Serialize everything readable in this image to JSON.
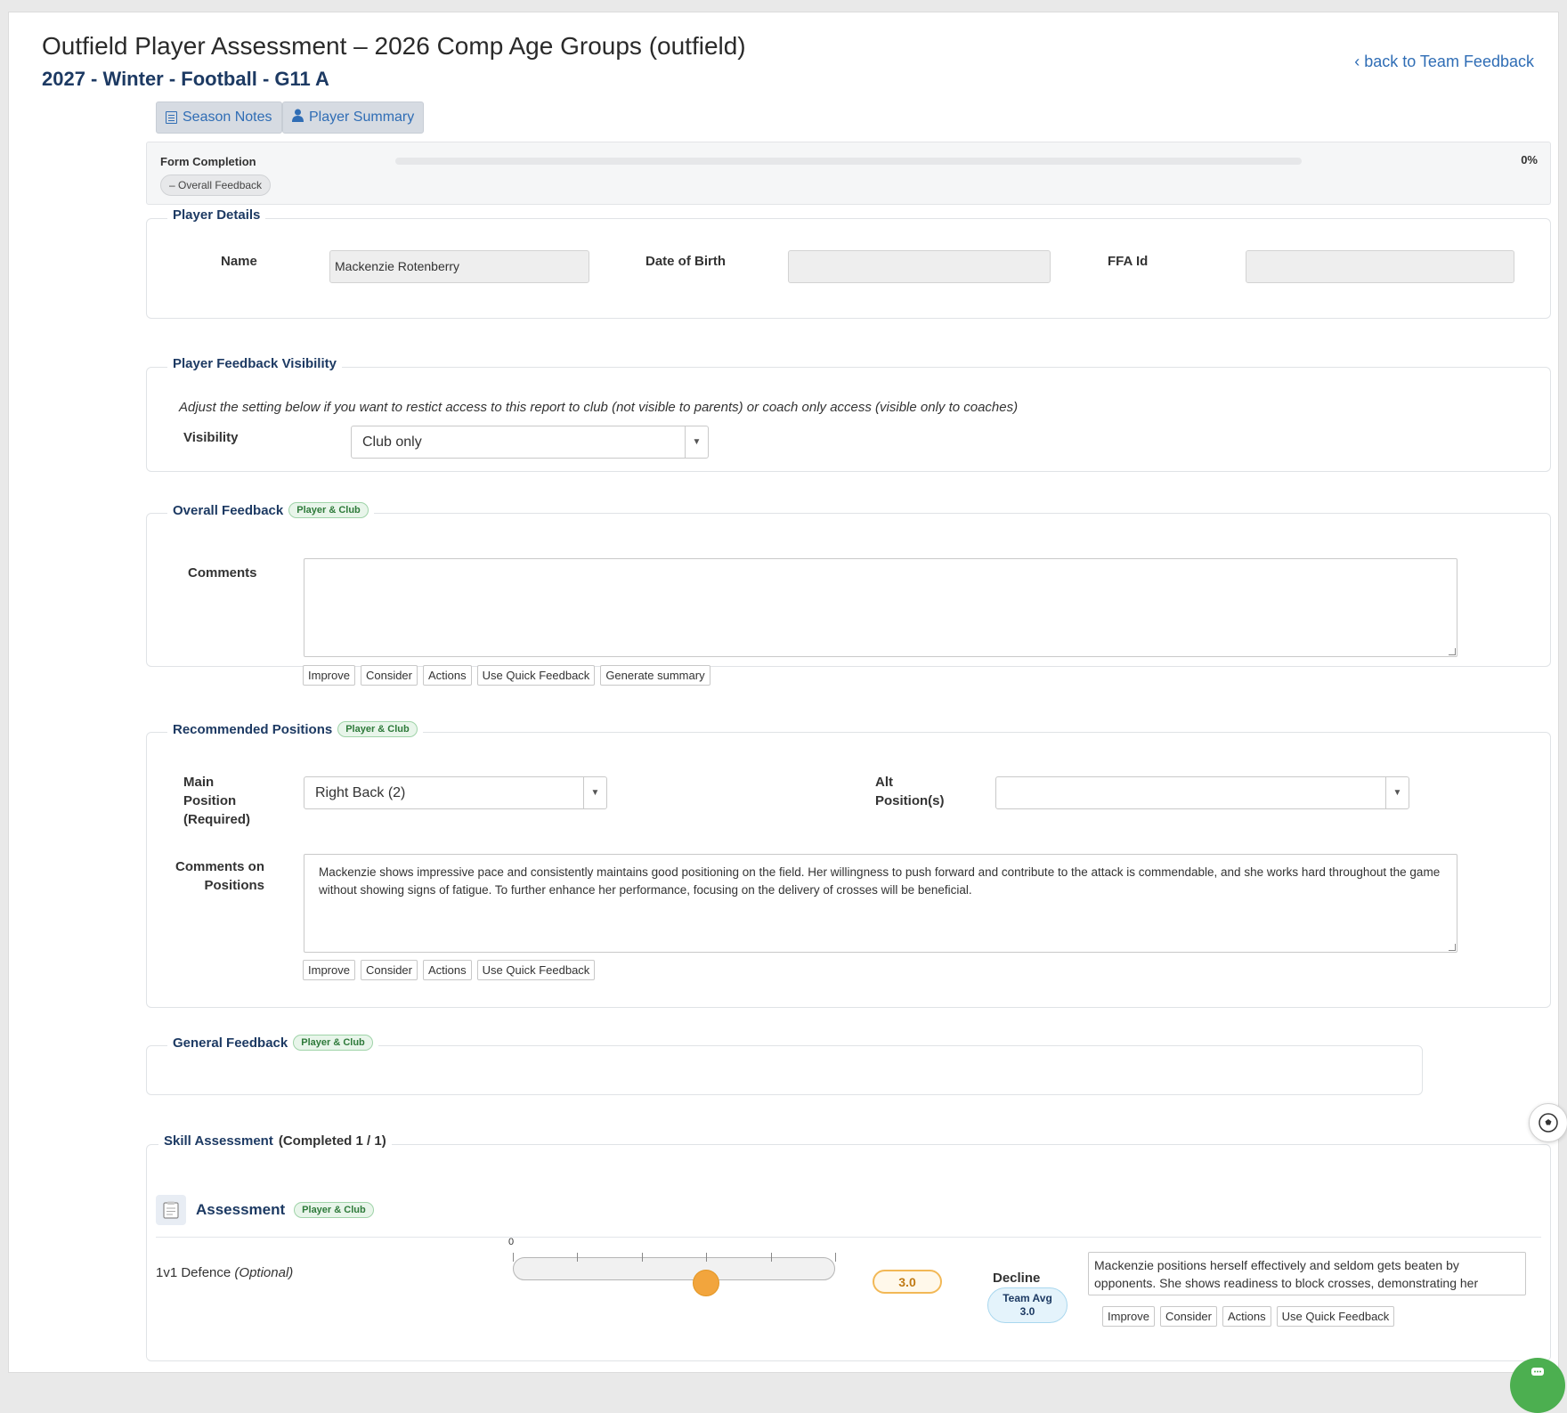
{
  "header": {
    "title": "Outfield Player Assessment – 2026 Comp Age Groups (outfield)",
    "subtitle": "2027 - Winter - Football - G11 A",
    "back_link": "‹ back to Team Feedback"
  },
  "toolbar": {
    "season_notes": "Season Notes",
    "player_summary": "Player Summary"
  },
  "completion": {
    "label": "Form Completion",
    "percent_text": "0%",
    "progress": 0,
    "toggle": "– Overall Feedback"
  },
  "player_details": {
    "legend": "Player Details",
    "name_label": "Name",
    "name_value": "Mackenzie Rotenberry",
    "dob_label": "Date of Birth",
    "dob_value": "",
    "ffa_label": "FFA Id",
    "ffa_value": ""
  },
  "visibility": {
    "legend": "Player Feedback Visibility",
    "info": "Adjust the setting below if you want to restict access to this report to club (not visible to parents) or coach only access (visible only to coaches)",
    "label": "Visibility",
    "selected": "Club only"
  },
  "overall_feedback": {
    "legend": "Overall Feedback",
    "badge": "Player & Club",
    "comments_label": "Comments",
    "comments_value": "",
    "buttons": [
      "Improve",
      "Consider",
      "Actions",
      "Use Quick Feedback",
      "Generate summary"
    ]
  },
  "positions": {
    "legend": "Recommended Positions",
    "badge": "Player & Club",
    "main_label": "Main Position (Required)",
    "main_value": "Right Back (2)",
    "alt_label": "Alt Position(s)",
    "alt_value": "",
    "comments_label": "Comments on Positions",
    "comments_value": "Mackenzie shows impressive pace and consistently maintains good positioning on the field. Her willingness to push forward and contribute to the attack is commendable, and she works hard throughout the game without showing signs of fatigue. To further enhance her performance, focusing on the delivery of crosses will be beneficial.",
    "buttons": [
      "Improve",
      "Consider",
      "Actions",
      "Use Quick Feedback"
    ]
  },
  "general_feedback": {
    "legend": "General Feedback",
    "badge": "Player & Club"
  },
  "skill_assessment": {
    "legend_bold": "Skill Assessment",
    "legend_rest": "(Completed 1 / 1)",
    "section_title": "Assessment",
    "section_badge": "Player & Club",
    "skill_name": "1v1 Defence",
    "skill_optional": "(Optional)",
    "slider_min_label": "0",
    "slider_value": 3.0,
    "score_text": "3.0",
    "decline_label": "Decline",
    "team_avg_label": "Team Avg",
    "team_avg_value": "3.0",
    "comment_value": "Mackenzie positions herself effectively and seldom gets beaten by opponents. She shows readiness to block crosses, demonstrating her",
    "buttons": [
      "Improve",
      "Consider",
      "Actions",
      "Use Quick Feedback"
    ]
  },
  "colors": {
    "accent_blue": "#2f6db5",
    "heading_navy": "#1d3a63",
    "badge_green": "#2e7a3a",
    "slider_orange": "#f2a53d",
    "chat_green": "#4caf50"
  },
  "icons": {
    "season_notes": "notes-icon",
    "player_summary": "person-icon",
    "assessment": "clipboard-icon",
    "side": "soccer-ball-icon",
    "chat": "chat-icon"
  }
}
